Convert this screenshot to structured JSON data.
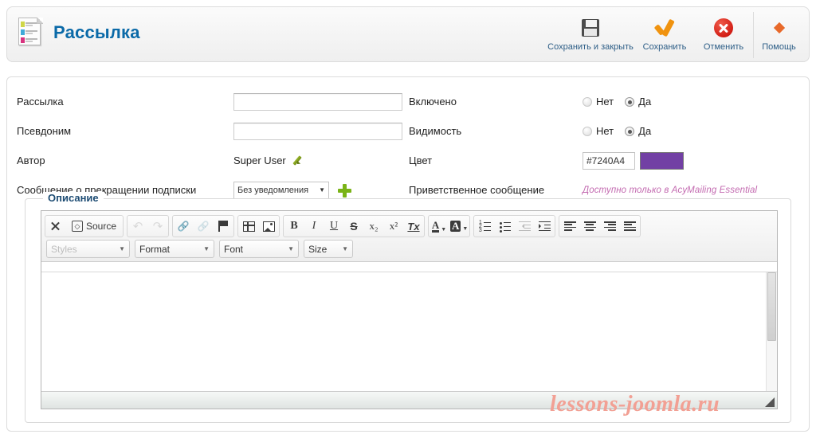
{
  "header": {
    "title": "Рассылка",
    "icon": "newsletter-document-icon",
    "toolbar": [
      {
        "label": "Сохранить и закрыть",
        "icon": "floppy-disk-icon"
      },
      {
        "label": "Сохранить",
        "icon": "orange-check-icon"
      },
      {
        "label": "Отменить",
        "icon": "red-x-circle-icon"
      },
      {
        "label": "Помощь",
        "icon": "four-arrows-icon"
      }
    ]
  },
  "form": {
    "left": {
      "newsletter_label": "Рассылка",
      "newsletter_value": "",
      "newsletter_placeholder": "",
      "alias_label": "Псевдоним",
      "alias_value": "",
      "alias_placeholder": "",
      "author_label": "Автор",
      "author_value": "Super User",
      "author_edit_icon": "pencil-icon",
      "unsubscribe_label": "Сообщение о прекращении подписки",
      "unsubscribe_value": "Без уведомления",
      "unsubscribe_options": [
        "Без уведомления"
      ],
      "add_icon": "plus-icon"
    },
    "right": {
      "enabled_label": "Включено",
      "enabled_no": "Нет",
      "enabled_yes": "Да",
      "enabled_selected": "Да",
      "visibility_label": "Видимость",
      "visibility_no": "Нет",
      "visibility_yes": "Да",
      "visibility_selected": "Да",
      "color_label": "Цвет",
      "color_value": "#7240A4",
      "color_swatch": "#7240A4",
      "welcome_label": "Приветственное сообщение",
      "welcome_note": "Доступно только в AcyMailing Essential",
      "welcome_note_color": "#c36ab0"
    }
  },
  "description": {
    "legend": "Описание",
    "editor": {
      "row1": {
        "group1": [
          {
            "label": "",
            "icon": "maximize-icon",
            "disabled": false
          },
          {
            "label": "Source",
            "icon": "source-code-icon",
            "disabled": false
          }
        ],
        "group2": [
          {
            "label": "",
            "icon": "undo-arrow-icon",
            "disabled": true
          },
          {
            "label": "",
            "icon": "redo-arrow-icon",
            "disabled": true
          }
        ],
        "group3": [
          {
            "label": "",
            "icon": "link-icon",
            "disabled": false
          },
          {
            "label": "",
            "icon": "unlink-icon",
            "disabled": true
          },
          {
            "label": "",
            "icon": "anchor-flag-icon",
            "disabled": false
          }
        ],
        "group4": [
          {
            "label": "",
            "icon": "table-icon",
            "disabled": false
          },
          {
            "label": "",
            "icon": "image-icon",
            "disabled": false
          }
        ],
        "group5": [
          {
            "label": "B",
            "icon": "bold-icon",
            "disabled": false
          },
          {
            "label": "I",
            "icon": "italic-icon",
            "disabled": false
          },
          {
            "label": "U",
            "icon": "underline-icon",
            "disabled": false
          },
          {
            "label": "S",
            "icon": "strikethrough-icon",
            "disabled": false
          },
          {
            "label": "x₂",
            "icon": "subscript-icon",
            "disabled": false
          },
          {
            "label": "x²",
            "icon": "superscript-icon",
            "disabled": false
          },
          {
            "label": "Tx",
            "icon": "remove-format-icon",
            "disabled": false
          }
        ],
        "group6": [
          {
            "label": "A",
            "icon": "text-color-icon",
            "disabled": false
          },
          {
            "label": "A",
            "icon": "background-color-icon",
            "disabled": false
          }
        ],
        "group7": [
          {
            "label": "",
            "icon": "numbered-list-icon",
            "disabled": false
          },
          {
            "label": "",
            "icon": "bulleted-list-icon",
            "disabled": false
          },
          {
            "label": "",
            "icon": "outdent-icon",
            "disabled": true
          },
          {
            "label": "",
            "icon": "indent-icon",
            "disabled": false
          }
        ],
        "group8": [
          {
            "label": "",
            "icon": "align-left-icon",
            "disabled": false
          },
          {
            "label": "",
            "icon": "align-center-icon",
            "disabled": false
          },
          {
            "label": "",
            "icon": "align-right-icon",
            "disabled": false
          },
          {
            "label": "",
            "icon": "align-justify-icon",
            "disabled": false
          }
        ]
      },
      "row2": [
        {
          "label": "Styles",
          "disabled": true
        },
        {
          "label": "Format",
          "disabled": false
        },
        {
          "label": "Font",
          "disabled": false
        },
        {
          "label": "Size",
          "disabled": false
        }
      ],
      "content": ""
    }
  },
  "watermark": "lessons-joomla.ru"
}
